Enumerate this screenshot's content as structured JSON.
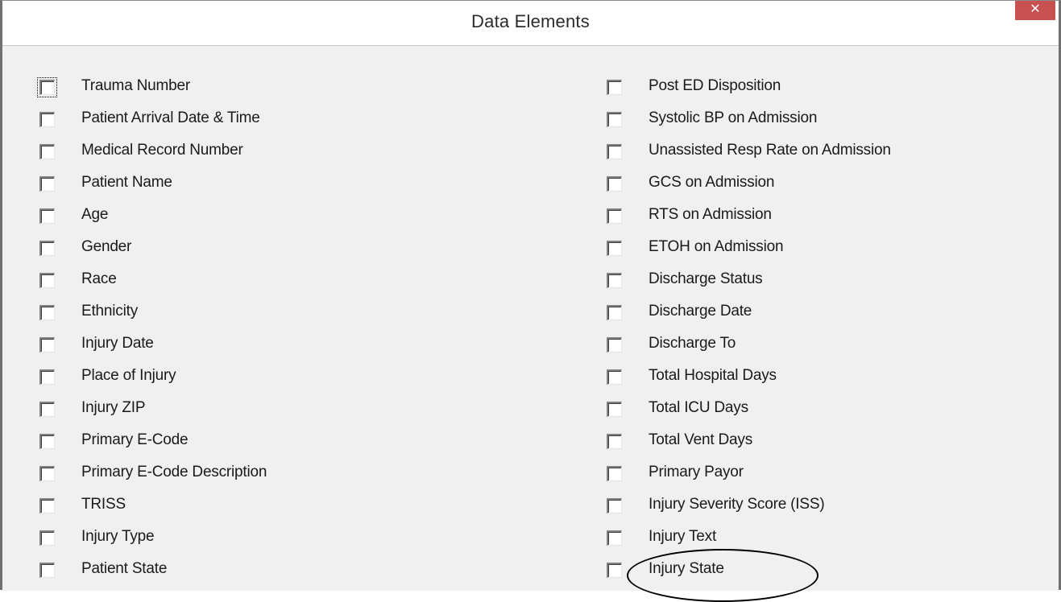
{
  "window": {
    "title": "Data Elements",
    "close_label": "✕"
  },
  "left_column": [
    {
      "label": "Trauma Number",
      "checked": false,
      "focused": true
    },
    {
      "label": "Patient Arrival Date & Time",
      "checked": false
    },
    {
      "label": "Medical Record Number",
      "checked": false
    },
    {
      "label": "Patient Name",
      "checked": false
    },
    {
      "label": "Age",
      "checked": false
    },
    {
      "label": "Gender",
      "checked": false
    },
    {
      "label": "Race",
      "checked": false
    },
    {
      "label": "Ethnicity",
      "checked": false
    },
    {
      "label": "Injury Date",
      "checked": false
    },
    {
      "label": "Place of Injury",
      "checked": false
    },
    {
      "label": "Injury ZIP",
      "checked": false
    },
    {
      "label": "Primary E-Code",
      "checked": false
    },
    {
      "label": "Primary E-Code Description",
      "checked": false
    },
    {
      "label": "TRISS",
      "checked": false
    },
    {
      "label": "Injury Type",
      "checked": false
    },
    {
      "label": "Patient State",
      "checked": false
    }
  ],
  "right_column": [
    {
      "label": "Post ED Disposition",
      "checked": false
    },
    {
      "label": "Systolic BP on Admission",
      "checked": false
    },
    {
      "label": "Unassisted Resp Rate on Admission",
      "checked": false
    },
    {
      "label": "GCS on Admission",
      "checked": false
    },
    {
      "label": "RTS on Admission",
      "checked": false
    },
    {
      "label": "ETOH on Admission",
      "checked": false
    },
    {
      "label": "Discharge Status",
      "checked": false
    },
    {
      "label": "Discharge Date",
      "checked": false
    },
    {
      "label": "Discharge To",
      "checked": false
    },
    {
      "label": "Total Hospital Days",
      "checked": false
    },
    {
      "label": "Total ICU Days",
      "checked": false
    },
    {
      "label": "Total Vent Days",
      "checked": false
    },
    {
      "label": "Primary Payor",
      "checked": false
    },
    {
      "label": "Injury Severity Score (ISS)",
      "checked": false
    },
    {
      "label": "Injury Text",
      "checked": false
    },
    {
      "label": "Injury State",
      "checked": false,
      "annotated": true
    }
  ],
  "colors": {
    "close_button": "#c75050",
    "dialog_background": "#f0f0f0"
  }
}
